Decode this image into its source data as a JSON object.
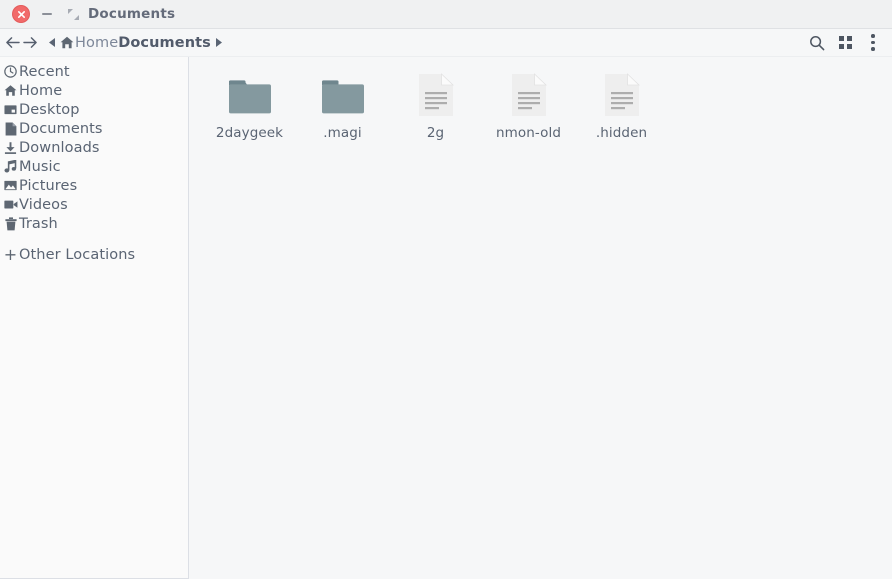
{
  "window": {
    "title": "Documents",
    "controls": [
      {
        "name": "close",
        "icon": "close-icon"
      },
      {
        "name": "minimize",
        "icon": "minimize-icon"
      },
      {
        "name": "maximize",
        "icon": "restore-icon"
      }
    ]
  },
  "toolbar": {
    "back_icon": "←",
    "forward_icon": "→",
    "left_triangle": "◀",
    "right_triangle": "▶",
    "breadcrumb": {
      "home_label": "Home",
      "current_label": "Documents"
    },
    "actions": [
      {
        "name": "search",
        "icon": "search-icon"
      },
      {
        "name": "view-grid",
        "icon": "grid-view-icon"
      },
      {
        "name": "menu",
        "icon": "overflow-menu-icon"
      }
    ]
  },
  "sidebar": {
    "items": [
      {
        "label": "Recent",
        "icon": "clock-icon"
      },
      {
        "label": "Home",
        "icon": "home-icon"
      },
      {
        "label": "Desktop",
        "icon": "desktop-icon"
      },
      {
        "label": "Documents",
        "icon": "document-icon"
      },
      {
        "label": "Downloads",
        "icon": "download-icon"
      },
      {
        "label": "Music",
        "icon": "music-note-icon"
      },
      {
        "label": "Pictures",
        "icon": "picture-icon"
      },
      {
        "label": "Videos",
        "icon": "video-camera-icon"
      },
      {
        "label": "Trash",
        "icon": "trash-icon"
      }
    ],
    "other_locations": {
      "label": "Other Locations",
      "icon": "plus-icon"
    }
  },
  "files": [
    {
      "name": "2daygeek",
      "type": "folder"
    },
    {
      "name": ".magi",
      "type": "folder"
    },
    {
      "name": "2g",
      "type": "document"
    },
    {
      "name": "nmon-old",
      "type": "document"
    },
    {
      "name": ".hidden",
      "type": "document"
    }
  ],
  "colors": {
    "folder": "#84999f",
    "folder_tab": "#6f868e",
    "document": "#eeeeee",
    "document_lines": "#adadad",
    "text": "#5a6473",
    "title_text": "#646b7a",
    "close_button": "#f16a6a",
    "sidebar_bg": "#fafafa",
    "content_bg": "#f6f7f8",
    "titlebar_bg": "#f0f1f2"
  }
}
